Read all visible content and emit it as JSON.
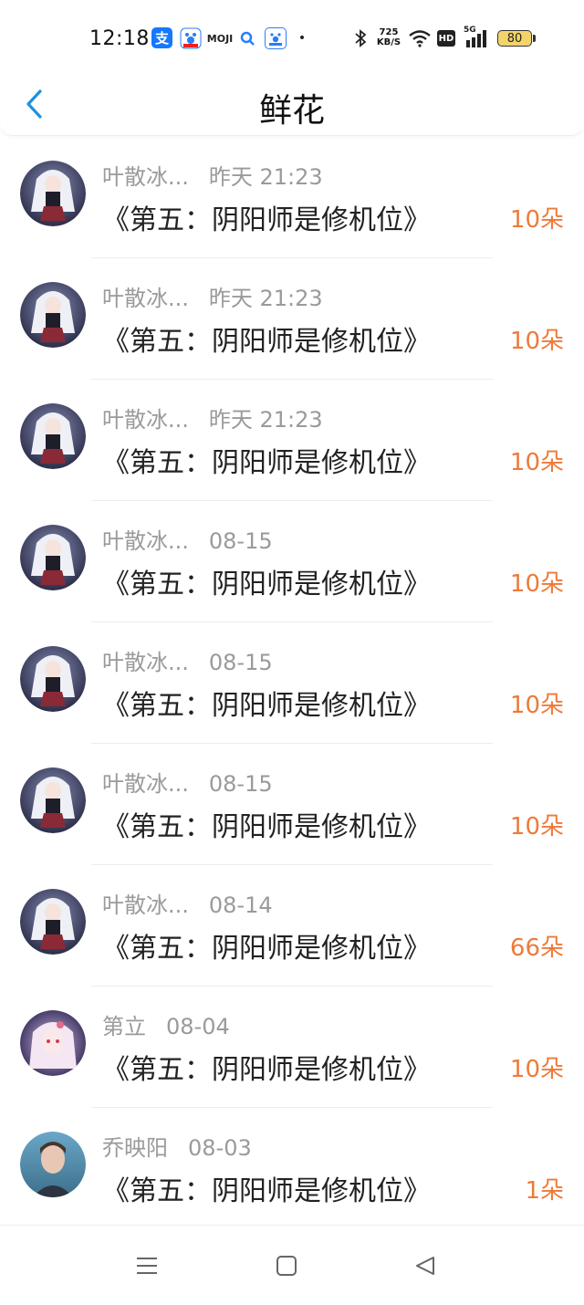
{
  "status_bar": {
    "time": "12:18",
    "app_icons": [
      "alipay-icon",
      "baidu-icon",
      "moji-icon",
      "search-icon",
      "baidu-app-icon"
    ],
    "alipay_glyph": "支",
    "moji_text": "MOJI",
    "dot": "•",
    "speed_value": "725",
    "speed_unit": "KB/S",
    "hd_label": "HD",
    "network": "5G",
    "battery": "80"
  },
  "header": {
    "title": "鲜花",
    "back_icon": "chevron-left-icon"
  },
  "flowers": [
    {
      "user": "叶散冰...",
      "date": "昨天 21:23",
      "book": "《第五：阴阳师是修机位》",
      "amount": "10朵",
      "avatar": "anime-girl-dark"
    },
    {
      "user": "叶散冰...",
      "date": "昨天 21:23",
      "book": "《第五：阴阳师是修机位》",
      "amount": "10朵",
      "avatar": "anime-girl-dark"
    },
    {
      "user": "叶散冰...",
      "date": "昨天 21:23",
      "book": "《第五：阴阳师是修机位》",
      "amount": "10朵",
      "avatar": "anime-girl-dark"
    },
    {
      "user": "叶散冰...",
      "date": "08-15",
      "book": "《第五：阴阳师是修机位》",
      "amount": "10朵",
      "avatar": "anime-girl-dark"
    },
    {
      "user": "叶散冰...",
      "date": "08-15",
      "book": "《第五：阴阳师是修机位》",
      "amount": "10朵",
      "avatar": "anime-girl-dark"
    },
    {
      "user": "叶散冰...",
      "date": "08-15",
      "book": "《第五：阴阳师是修机位》",
      "amount": "10朵",
      "avatar": "anime-girl-dark"
    },
    {
      "user": "叶散冰...",
      "date": "08-14",
      "book": "《第五：阴阳师是修机位》",
      "amount": "66朵",
      "avatar": "anime-girl-dark"
    },
    {
      "user": "第立",
      "date": "08-04",
      "book": "《第五：阴阳师是修机位》",
      "amount": "10朵",
      "avatar": "anime-girl-pink"
    },
    {
      "user": "乔映阳",
      "date": "08-03",
      "book": "《第五：阴阳师是修机位》",
      "amount": "1朵",
      "avatar": "person-photo"
    }
  ],
  "nav": {
    "menu_icon": "menu-icon",
    "home_icon": "home-square-icon",
    "back_icon": "back-triangle-icon"
  },
  "colors": {
    "accent": "#1e90e0",
    "amount": "#ee7a3a",
    "meta": "#9a9a9a"
  }
}
